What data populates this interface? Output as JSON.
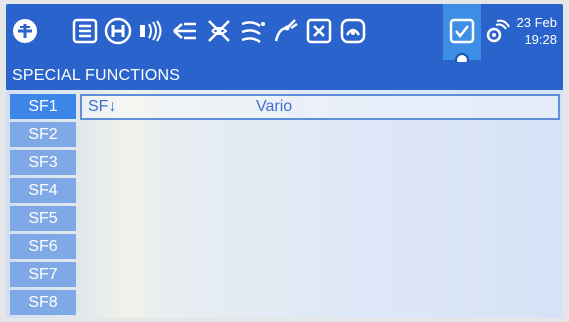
{
  "header": {
    "date": "23 Feb",
    "time": "19:28",
    "icons": [
      "model-select-icon",
      "list-icon",
      "heli-icon",
      "transmitter-icon",
      "mixer-icon",
      "fly-mode-icon",
      "curve-icon",
      "wire-icon",
      "logical-switch-icon",
      "telemetry-icon",
      "special-functions-icon",
      "sensor-icon"
    ]
  },
  "page": {
    "title": "SPECIAL FUNCTIONS"
  },
  "functions": [
    {
      "label": "SF1",
      "switch": "SF↓",
      "action": "Vario"
    },
    {
      "label": "SF2",
      "switch": "",
      "action": ""
    },
    {
      "label": "SF3",
      "switch": "",
      "action": ""
    },
    {
      "label": "SF4",
      "switch": "",
      "action": ""
    },
    {
      "label": "SF5",
      "switch": "",
      "action": ""
    },
    {
      "label": "SF6",
      "switch": "",
      "action": ""
    },
    {
      "label": "SF7",
      "switch": "",
      "action": ""
    },
    {
      "label": "SF8",
      "switch": "",
      "action": ""
    }
  ],
  "colors": {
    "header_bg": "#2a63cc",
    "active_tab": "#3d8fe6",
    "row_label_bg": "#7fa9e6",
    "selected_label_bg": "#3b86e6",
    "value_text": "#3f6fd0"
  }
}
